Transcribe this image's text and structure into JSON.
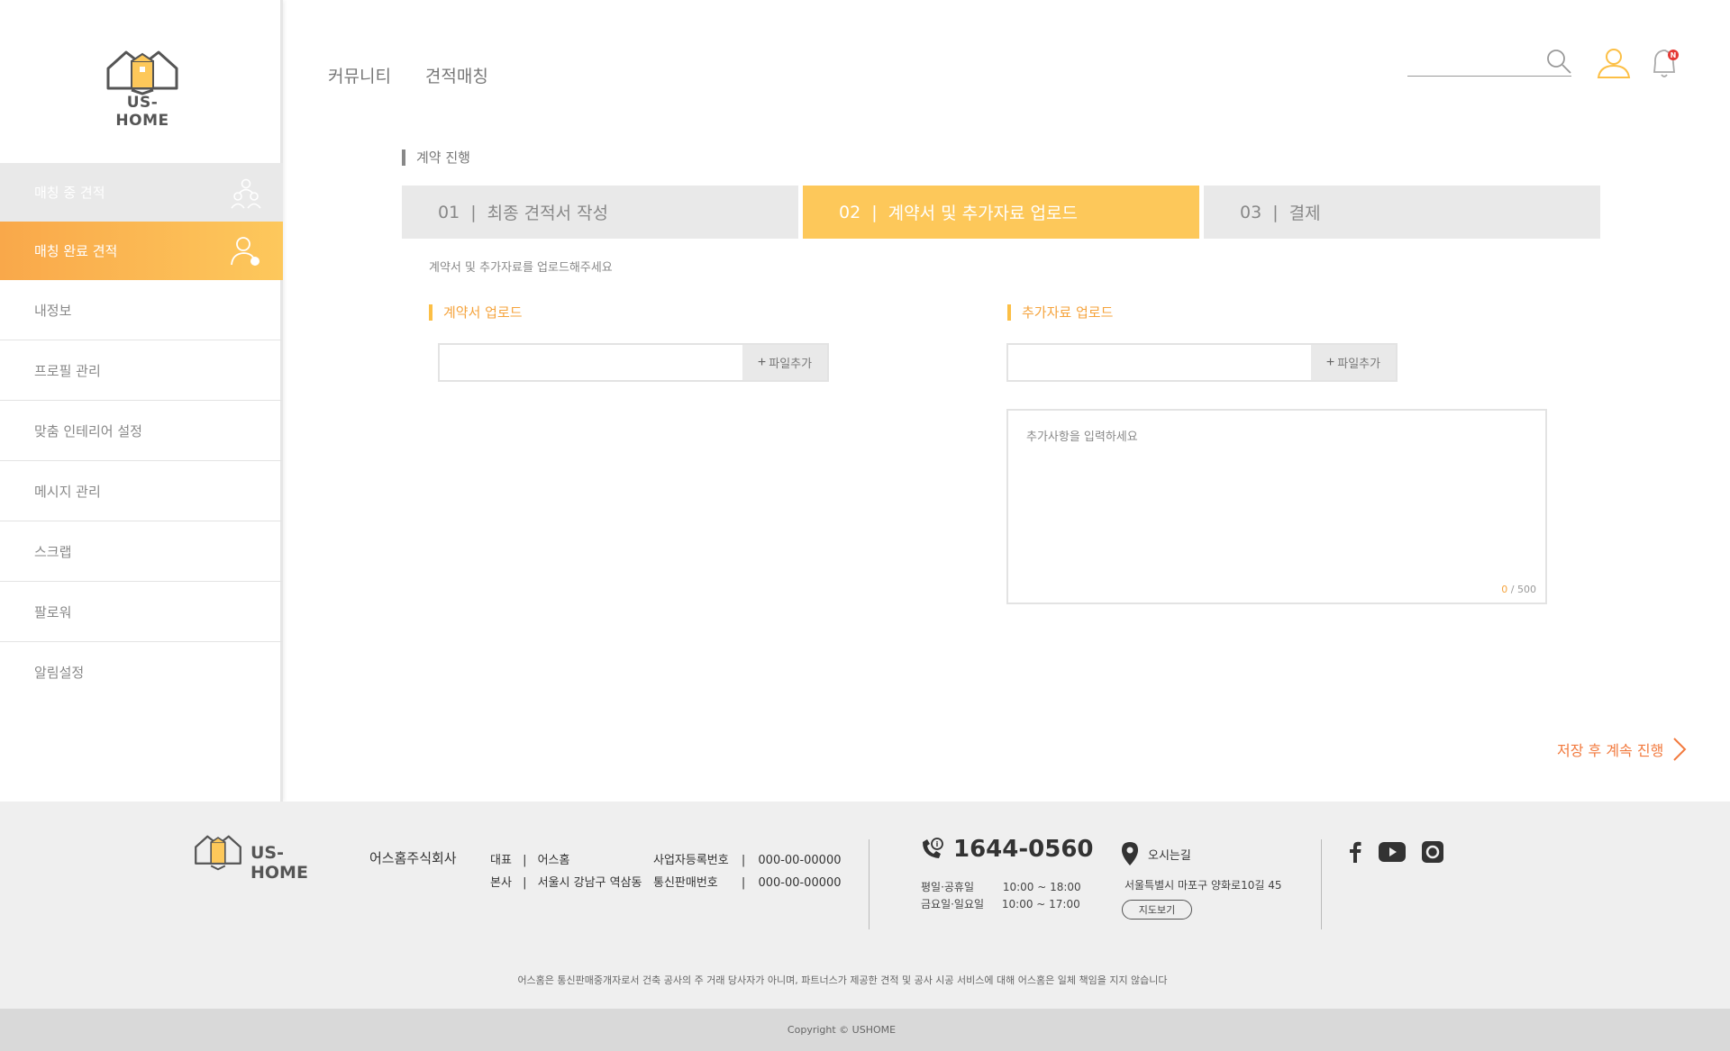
{
  "brand": {
    "logo_text": "US-HOME",
    "accent": "#fdc85a",
    "orange": "#f5a33c"
  },
  "topnav": {
    "items": [
      "커뮤니티",
      "견적매칭"
    ],
    "notification_badge": "N"
  },
  "sidebar": {
    "items": [
      {
        "label": "매칭 중 견적"
      },
      {
        "label": "매칭 완료 견적"
      },
      {
        "label": "내정보"
      },
      {
        "label": "프로필 관리"
      },
      {
        "label": "맞춤 인테리어 설정"
      },
      {
        "label": "메시지 관리"
      },
      {
        "label": "스크랩"
      },
      {
        "label": "팔로워"
      },
      {
        "label": "알림설정"
      }
    ]
  },
  "main": {
    "section_title": "계약 진행",
    "steps": [
      {
        "num": "01",
        "label": "최종 견적서 작성"
      },
      {
        "num": "02",
        "label": "계약서 및 추가자료 업로드"
      },
      {
        "num": "03",
        "label": "결제"
      }
    ],
    "step_separator": "|",
    "hint": "계약서 및 추가자료를 업로드해주세요",
    "contract_upload": {
      "title": "계약서 업로드",
      "button": "파일추가"
    },
    "extra_upload": {
      "title": "추가자료 업로드",
      "button": "파일추가"
    },
    "notes": {
      "placeholder": "추가사항을 입력하세요",
      "count": "0",
      "max": "/ 500"
    },
    "next_label": "저장 후 계속 진행"
  },
  "footer": {
    "logo_text": "US-HOME",
    "company": "어스홈주식회사",
    "rep_label": "대표",
    "rep_value": "어스홈",
    "hq_label": "본사",
    "hq_value": "서울시 강남구 역삼동",
    "sep": "|",
    "biz_label": "사업자등록번호",
    "biz_value": "000-00-00000",
    "mail_label": "통신판매번호",
    "mail_value": "000-00-00000",
    "phone": "1644-0560",
    "hours1_label": "평일·공휴일",
    "hours1_value": "10:00 ~ 18:00",
    "hours2_label": "금요일·일요일",
    "hours2_value": "10:00 ~ 17:00",
    "location_label": "오시는길",
    "address": "서울특별시 마포구 양화로10길 45",
    "map_button": "지도보기",
    "disclaimer": "어스홈은 통신판매중개자로서 건축 공사의 주 거래 당사자가 아니며, 파트너스가 제공한 견적 및 공사 시공 서비스에 대해 어스홈은 일체 책임을 지지 않습니다",
    "copyright": "Copyright © USHOME"
  }
}
